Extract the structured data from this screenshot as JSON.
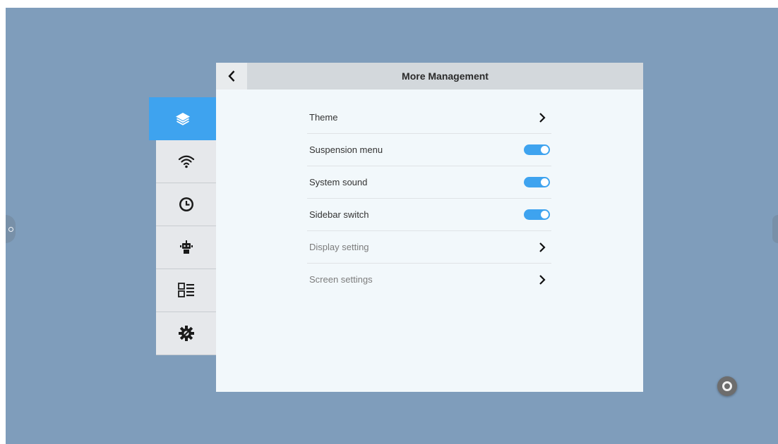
{
  "panel": {
    "title": "More Management",
    "back_icon": "chevron-left-icon"
  },
  "sidebar": {
    "items": [
      {
        "name": "layers",
        "icon": "layers-icon",
        "active": true
      },
      {
        "name": "wifi",
        "icon": "wifi-icon",
        "active": false
      },
      {
        "name": "clock",
        "icon": "clock-icon",
        "active": false
      },
      {
        "name": "robot",
        "icon": "robot-icon",
        "active": false
      },
      {
        "name": "apps",
        "icon": "list-grid-icon",
        "active": false
      },
      {
        "name": "tools",
        "icon": "gear-wrench-icon",
        "active": false
      }
    ]
  },
  "settings": [
    {
      "label": "Theme",
      "control": "chevron"
    },
    {
      "label": "Suspension menu",
      "control": "toggle",
      "on": true
    },
    {
      "label": "System sound",
      "control": "toggle",
      "on": true
    },
    {
      "label": "Sidebar switch",
      "control": "toggle",
      "on": true
    },
    {
      "label": "Display setting",
      "control": "chevron"
    },
    {
      "label": "Screen settings",
      "control": "chevron"
    }
  ],
  "colors": {
    "desktop": "#7f9dbb",
    "accent": "#3ea3ef",
    "panel_bg": "#f2f8fb",
    "header_bg": "#d3d8dc"
  }
}
